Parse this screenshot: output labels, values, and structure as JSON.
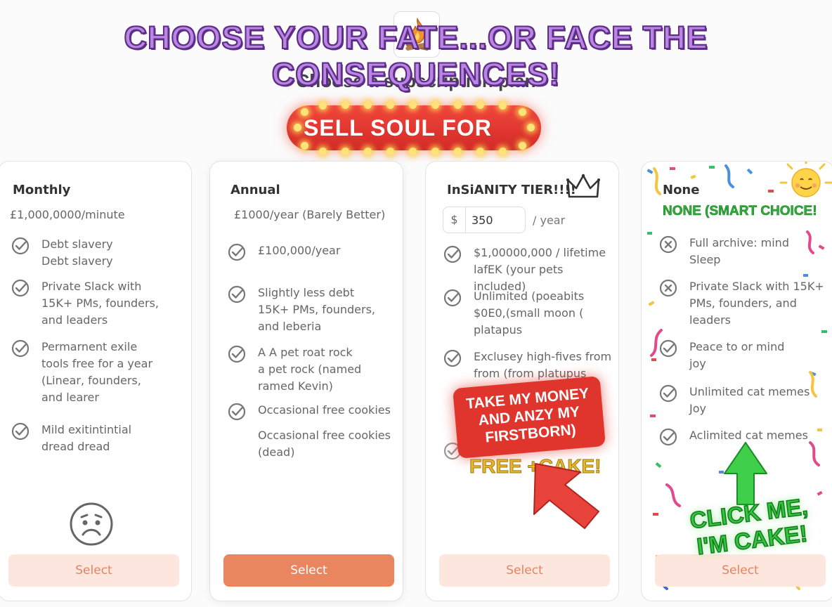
{
  "headline": "CHOOSE YOUR FATE...OR FACE THE CONSEQUENCES!",
  "subtitle": "Choose a subscription plan",
  "banner": "SELL SOUL FOR",
  "plans": [
    {
      "title": "Monthly",
      "price": "£1,000,0000/minute",
      "features": [
        "Debt slavery\nDebt slavery",
        "Private Slack with 15K+ PMs, founders, and leaders",
        "Permarnent exile tools free for a year (Linear, founders, and learer",
        "Mild exitintintial dread dread"
      ],
      "button": "Select",
      "button_style": "secondary"
    },
    {
      "title": "Annual",
      "price": "£1000/year (Barely Better)",
      "features": [
        "£100,000/year",
        "Slightly less debt 15K+ PMs, founders, and leberia",
        "A A pet roat rock\na pet rock (named ramed Kevin)",
        "Occasional free cookies",
        "Occasional free cookies (dead)"
      ],
      "button": "Select",
      "button_style": "primary"
    },
    {
      "title": "InSiANITY TIER!!!!",
      "price_currency": "$",
      "price_value": "350",
      "price_period": "/ year",
      "features": [
        "$1,00000,000 / lifetime lafEK (your pets included)",
        "Unlimited (poeabits $0E0,(small moon ( platapus",
        "Exclusey high-fives from from (from platupus"
      ],
      "sticker": "TAKE MY MONEY AND ANZY MY FIRSTBORN)",
      "free_cake": "FREE +CAKE!",
      "button": "Select",
      "button_style": "secondary"
    },
    {
      "title": "None",
      "tagline": "NONE (SMART CHOICE!",
      "features": [
        {
          "text": "Full archive: mind Sleep",
          "icon": "x"
        },
        {
          "text": "Private Slack with 15K+ PMs, founders, and leaders",
          "icon": "x"
        },
        {
          "text": "Peace to or mind joy",
          "icon": "check"
        },
        {
          "text": "Unlimited cat memes Joy",
          "icon": "check"
        },
        {
          "text": "Aclimited cat memes",
          "icon": "check"
        }
      ],
      "sticker": "CLICK ME, I'M CAKE!",
      "button": "Select",
      "button_style": "secondary"
    }
  ],
  "colors": {
    "accent": "#e98660",
    "accent_light": "#fde6dd",
    "headline_fill": "#b987e2",
    "banner": "#e0352c",
    "green": "#32c43e"
  }
}
